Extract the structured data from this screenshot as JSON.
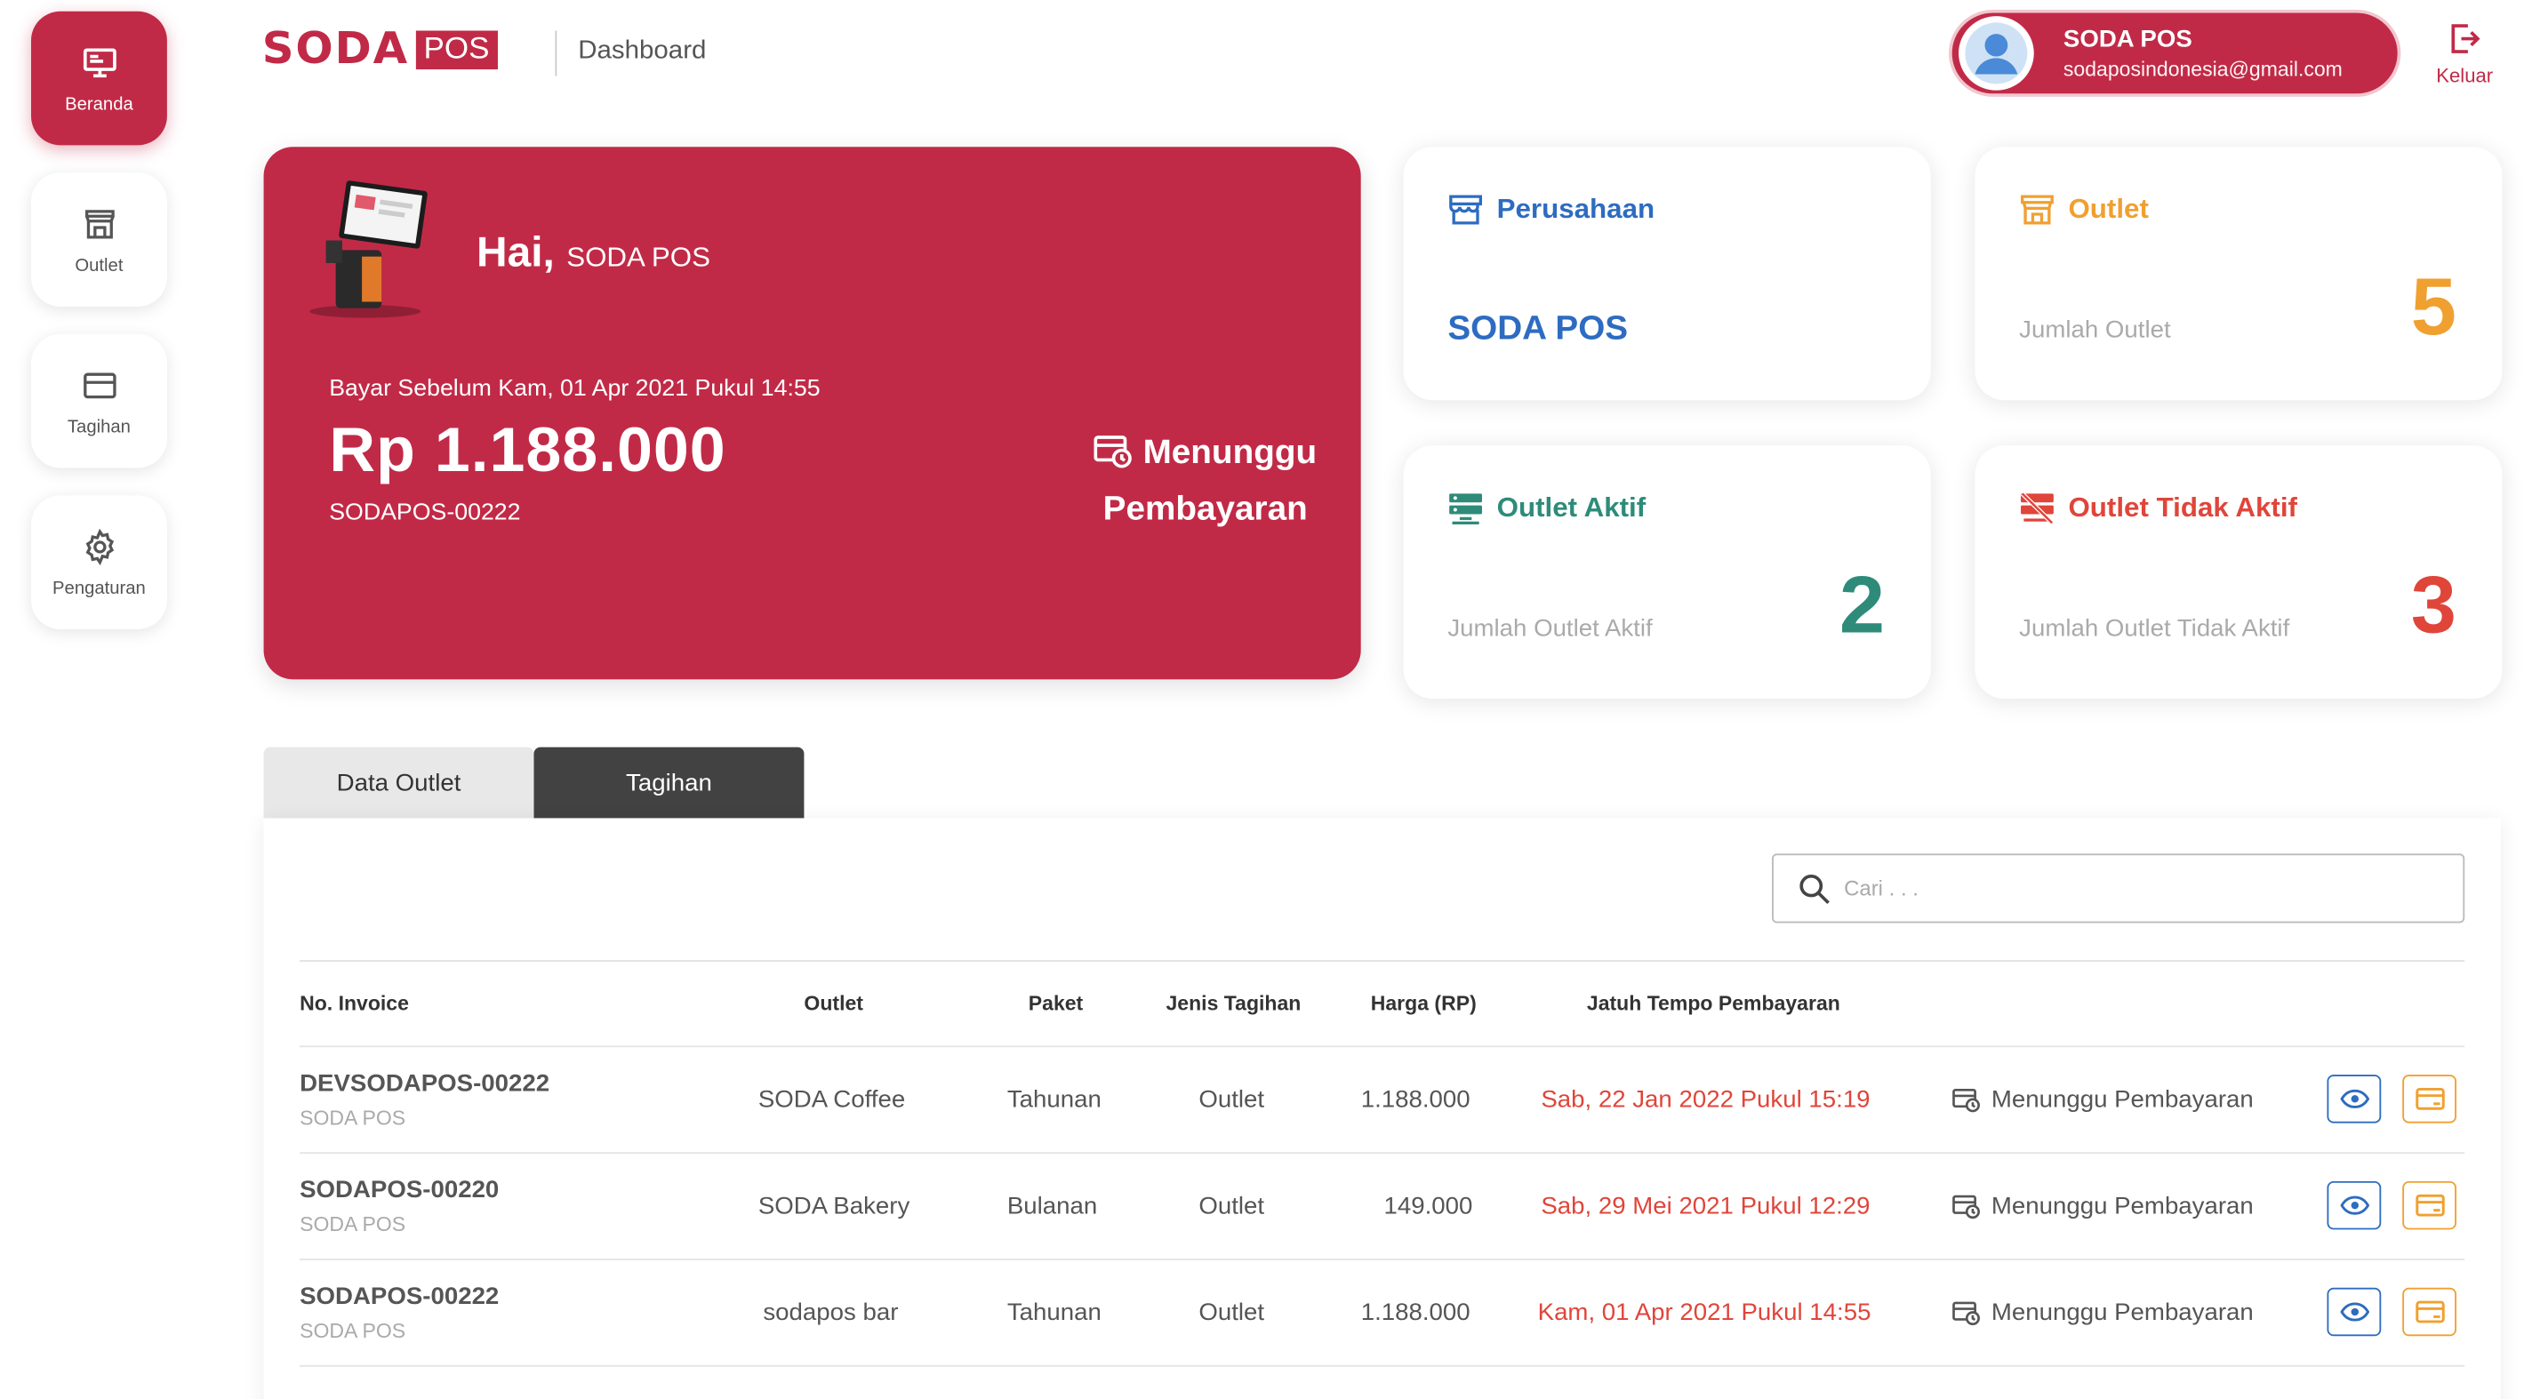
{
  "sidebar": {
    "items": [
      {
        "label": "Beranda",
        "icon": "monitor-icon",
        "active": true
      },
      {
        "label": "Outlet",
        "icon": "store-icon",
        "active": false
      },
      {
        "label": "Tagihan",
        "icon": "credit-card-icon",
        "active": false
      },
      {
        "label": "Pengaturan",
        "icon": "gear-icon",
        "active": false
      }
    ]
  },
  "header": {
    "logo_text": "SODA",
    "logo_badge": "POS",
    "page_title": "Dashboard",
    "user_name": "SODA POS",
    "user_email": "sodaposindonesia@gmail.com",
    "logout_label": "Keluar"
  },
  "billing": {
    "greeting": "Hai,",
    "greeting_name": "SODA POS",
    "due_text": "Bayar Sebelum Kam, 01 Apr 2021 Pukul 14:55",
    "amount": "Rp 1.188.000",
    "invoice": "SODAPOS-00222",
    "status_line1": "Menunggu",
    "status_line2": "Pembayaran"
  },
  "stats": {
    "company": {
      "title": "Perusahaan",
      "value": "SODA POS"
    },
    "outlet": {
      "title": "Outlet",
      "subtitle": "Jumlah Outlet",
      "value": "5"
    },
    "active": {
      "title": "Outlet Aktif",
      "subtitle": "Jumlah Outlet Aktif",
      "value": "2"
    },
    "inactive": {
      "title": "Outlet Tidak Aktif",
      "subtitle": "Jumlah Outlet Tidak Aktif",
      "value": "3"
    }
  },
  "tabs": [
    {
      "label": "Data Outlet",
      "active": false
    },
    {
      "label": "Tagihan",
      "active": true
    }
  ],
  "search": {
    "placeholder": "Cari . . ."
  },
  "table": {
    "headers": {
      "invoice": "No. Invoice",
      "outlet": "Outlet",
      "paket": "Paket",
      "jenis": "Jenis Tagihan",
      "harga": "Harga (RP)",
      "jatuh_tempo": "Jatuh Tempo Pembayaran"
    },
    "rows": [
      {
        "invoice": "DEVSODAPOS-00222",
        "company": "SODA POS",
        "outlet": "SODA Coffee",
        "paket": "Tahunan",
        "jenis": "Outlet",
        "harga": "1.188.000",
        "due": "Sab, 22 Jan 2022 Pukul 15:19",
        "status": "Menunggu Pembayaran"
      },
      {
        "invoice": "SODAPOS-00220",
        "company": "SODA POS",
        "outlet": "SODA Bakery",
        "paket": "Bulanan",
        "jenis": "Outlet",
        "harga": "149.000",
        "due": "Sab, 29 Mei 2021 Pukul 12:29",
        "status": "Menunggu Pembayaran"
      },
      {
        "invoice": "SODAPOS-00222",
        "company": "SODA POS",
        "outlet": "sodapos bar",
        "paket": "Tahunan",
        "jenis": "Outlet",
        "harga": "1.188.000",
        "due": "Kam, 01 Apr 2021 Pukul 14:55",
        "status": "Menunggu Pembayaran"
      }
    ]
  },
  "colors": {
    "brand": "#c12a47",
    "blue": "#2d6cc0",
    "orange": "#f0a030",
    "green": "#2e8b7a",
    "red": "#e0453a"
  }
}
